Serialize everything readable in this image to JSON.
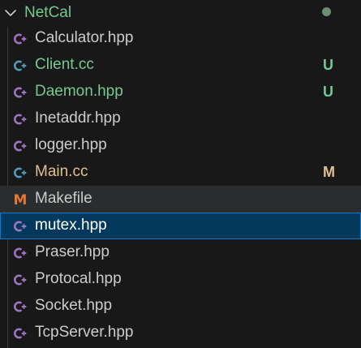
{
  "colors": {
    "folder_text": "#73c991",
    "text_default": "#cccccc",
    "text_untracked": "#73c991",
    "text_modified": "#e2c08d",
    "cpp_icon": "#a074c4",
    "cc_icon": "#519aba",
    "makefile_icon": "#e37933",
    "dot": "#6b8f71"
  },
  "folder": {
    "name": "NetCal",
    "icon": "chevron-down-icon"
  },
  "files": [
    {
      "name": "Calculator.hpp",
      "icon": "cpp-header-icon",
      "status": "",
      "state": "normal",
      "label_color": "#cccccc",
      "icon_color": "#a074c4",
      "badge_color": ""
    },
    {
      "name": "Client.cc",
      "icon": "cpp-source-icon",
      "status": "U",
      "state": "normal",
      "label_color": "#73c991",
      "icon_color": "#519aba",
      "badge_color": "#73c991"
    },
    {
      "name": "Daemon.hpp",
      "icon": "cpp-header-icon",
      "status": "U",
      "state": "normal",
      "label_color": "#73c991",
      "icon_color": "#a074c4",
      "badge_color": "#73c991"
    },
    {
      "name": "Inetaddr.hpp",
      "icon": "cpp-header-icon",
      "status": "",
      "state": "normal",
      "label_color": "#cccccc",
      "icon_color": "#a074c4",
      "badge_color": ""
    },
    {
      "name": "logger.hpp",
      "icon": "cpp-header-icon",
      "status": "",
      "state": "normal",
      "label_color": "#cccccc",
      "icon_color": "#a074c4",
      "badge_color": ""
    },
    {
      "name": "Main.cc",
      "icon": "cpp-source-icon",
      "status": "M",
      "state": "normal",
      "label_color": "#e2c08d",
      "icon_color": "#519aba",
      "badge_color": "#e2c08d"
    },
    {
      "name": "Makefile",
      "icon": "makefile-icon",
      "status": "",
      "state": "hover",
      "label_color": "#cccccc",
      "icon_color": "#e37933",
      "badge_color": ""
    },
    {
      "name": "mutex.hpp",
      "icon": "cpp-header-icon",
      "status": "",
      "state": "selected",
      "label_color": "#ffffff",
      "icon_color": "#a074c4",
      "badge_color": ""
    },
    {
      "name": "Praser.hpp",
      "icon": "cpp-header-icon",
      "status": "",
      "state": "normal",
      "label_color": "#cccccc",
      "icon_color": "#a074c4",
      "badge_color": ""
    },
    {
      "name": "Protocal.hpp",
      "icon": "cpp-header-icon",
      "status": "",
      "state": "normal",
      "label_color": "#cccccc",
      "icon_color": "#a074c4",
      "badge_color": ""
    },
    {
      "name": "Socket.hpp",
      "icon": "cpp-header-icon",
      "status": "",
      "state": "normal",
      "label_color": "#cccccc",
      "icon_color": "#a074c4",
      "badge_color": ""
    },
    {
      "name": "TcpServer.hpp",
      "icon": "cpp-header-icon",
      "status": "",
      "state": "normal",
      "label_color": "#cccccc",
      "icon_color": "#a074c4",
      "badge_color": ""
    }
  ]
}
